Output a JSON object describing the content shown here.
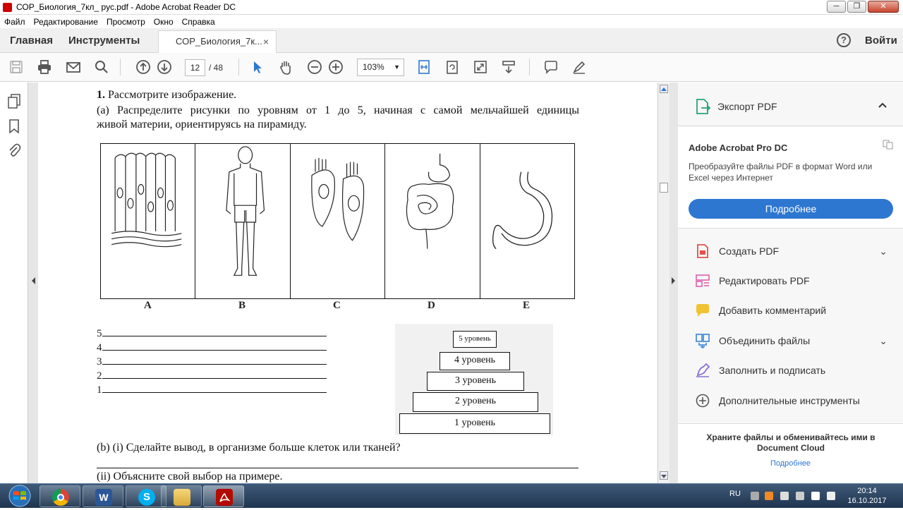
{
  "window": {
    "title": "СОР_Биология_7кл_ рус.pdf - Adobe Acrobat Reader DC",
    "minimize": "─",
    "restore": "❐",
    "close": "✕"
  },
  "menu": [
    "Файл",
    "Редактирование",
    "Просмотр",
    "Окно",
    "Справка"
  ],
  "tabs": {
    "home": "Главная",
    "tools": "Инструменты",
    "document": "СОР_Биология_7к...",
    "close": "×",
    "help": "?",
    "login": "Войти"
  },
  "toolbar": {
    "page_current": "12",
    "page_total": "/ 48",
    "zoom": "103%",
    "zoom_arrow": "▼"
  },
  "document": {
    "q_number": "1.",
    "q_title": "Рассмотрите изображение.",
    "q_a_line1": "(a) Распределите рисунки по уровням от 1 до 5, начиная с самой мельчайшей единицы",
    "q_a_line2": "живой материи, ориентируясь на пирамиду.",
    "image_letters": [
      "A",
      "B",
      "C",
      "D",
      "E"
    ],
    "answer_numbers": [
      "5",
      "4",
      "3",
      "2",
      "1"
    ],
    "pyramid_levels": [
      "5 уровень",
      "4 уровень",
      "3 уровень",
      "2 уровень",
      "1 уровень"
    ],
    "q_b": "(b) (i) Сделайте вывод, в организме больше клеток или тканей?",
    "q_b_ii": "(ii) Объясните свой выбор на примере."
  },
  "right_panel": {
    "export_label": "Экспорт PDF",
    "promo_title": "Adobe Acrobat Pro DC",
    "promo_text": "Преобразуйте файлы PDF в формат Word или Excel через Интернет",
    "promo_button": "Подробнее",
    "tools": [
      {
        "label": "Создать PDF",
        "icon": "create-pdf-icon",
        "color": "#e0534a"
      },
      {
        "label": "Редактировать PDF",
        "icon": "edit-pdf-icon",
        "color": "#e26fb1"
      },
      {
        "label": "Добавить комментарий",
        "icon": "comment-icon",
        "color": "#f1c232"
      },
      {
        "label": "Объединить файлы",
        "icon": "combine-files-icon",
        "color": "#4a90d9"
      },
      {
        "label": "Заполнить и подписать",
        "icon": "fill-sign-icon",
        "color": "#8a6ed6"
      },
      {
        "label": "Дополнительные инструменты",
        "icon": "more-tools-icon",
        "color": "#555555"
      }
    ],
    "cloud_text": "Храните файлы и обменивайтесь ими в Document Cloud",
    "cloud_link": "Подробнее"
  },
  "taskbar": {
    "lang": "RU",
    "time": "20:14",
    "date": "16.10.2017"
  },
  "colors": {
    "accent_blue": "#2e77d0",
    "export_green": "#27a47e"
  }
}
